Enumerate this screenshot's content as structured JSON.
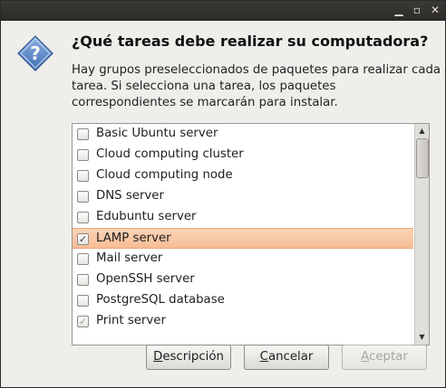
{
  "titlebar": {
    "minimize_glyph": "▁",
    "maximize_glyph": "▫",
    "close_glyph": "✕"
  },
  "dialog": {
    "icon": "question-icon",
    "headline": "¿Qué tareas debe realizar su computadora?",
    "description_lines": [
      "Hay grupos preseleccionados de paquetes para realizar cada",
      "tarea. Si selecciona una tarea, los paquetes",
      "correspondientes se marcarán para instalar."
    ]
  },
  "tasks": [
    {
      "label": "Basic Ubuntu server",
      "checked": false,
      "selected": false
    },
    {
      "label": "Cloud computing cluster",
      "checked": false,
      "selected": false
    },
    {
      "label": "Cloud computing node",
      "checked": false,
      "selected": false
    },
    {
      "label": "DNS server",
      "checked": false,
      "selected": false
    },
    {
      "label": "Edubuntu server",
      "checked": false,
      "selected": false
    },
    {
      "label": "LAMP server",
      "checked": true,
      "selected": true
    },
    {
      "label": "Mail server",
      "checked": false,
      "selected": false
    },
    {
      "label": "OpenSSH server",
      "checked": false,
      "selected": false
    },
    {
      "label": "PostgreSQL database",
      "checked": false,
      "selected": false
    },
    {
      "label": "Print server",
      "checked": true,
      "selected": false
    }
  ],
  "buttons": {
    "description": {
      "mnemonic": "D",
      "rest": "escripción"
    },
    "cancel": {
      "mnemonic": "C",
      "rest": "ancelar"
    },
    "accept": {
      "mnemonic": "A",
      "rest": "ceptar",
      "enabled": false
    }
  },
  "colors": {
    "selection": "#f7be96",
    "window_bg": "#efeeeb",
    "titlebar": "#33322e"
  }
}
